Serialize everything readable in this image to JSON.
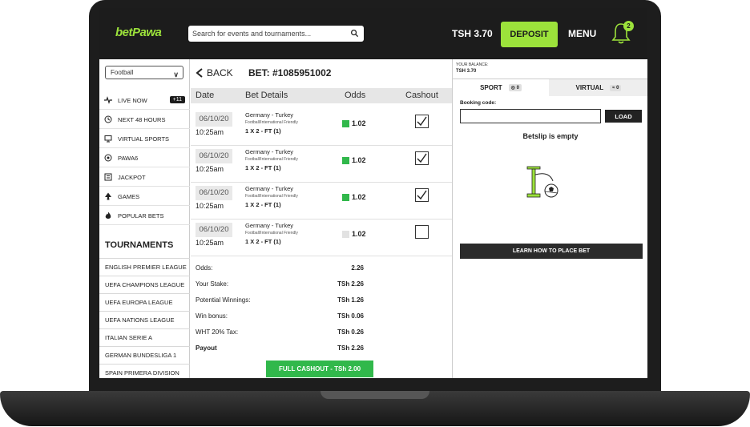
{
  "header": {
    "logo": "betPawa",
    "search_placeholder": "Search for events and tournaments...",
    "balance": "TSH 3.70",
    "deposit_label": "DEPOSIT",
    "menu_label": "MENU",
    "notification_count": "2"
  },
  "sidebar": {
    "sport_select": "Football",
    "nav": [
      {
        "label": "LIVE NOW",
        "icon": "pulse-icon",
        "count": "+11"
      },
      {
        "label": "NEXT 48 HOURS",
        "icon": "clock-icon"
      },
      {
        "label": "VIRTUAL SPORTS",
        "icon": "monitor-icon"
      },
      {
        "label": "PAWA6",
        "icon": "ball-icon"
      },
      {
        "label": "JACKPOT",
        "icon": "jackpot-icon"
      },
      {
        "label": "GAMES",
        "icon": "spade-icon"
      },
      {
        "label": "POPULAR BETS",
        "icon": "flame-icon"
      }
    ],
    "tournaments_heading": "TOURNAMENTS",
    "tournaments": [
      "ENGLISH PREMIER LEAGUE",
      "UEFA CHAMPIONS LEAGUE",
      "UEFA EUROPA LEAGUE",
      "UEFA NATIONS LEAGUE",
      "ITALIAN SERIE A",
      "GERMAN BUNDESLIGA 1",
      "SPAIN PRIMERA DIVISION"
    ]
  },
  "bet": {
    "back_label": "BACK",
    "title": "BET: #1085951002",
    "columns": [
      "Date",
      "Bet Details",
      "Odds",
      "Cashout"
    ],
    "rows": [
      {
        "date": "06/10/20",
        "time": "10:25am",
        "match": "Germany - Turkey",
        "competition": "Football/International Friendly",
        "pick": "1 X 2 - FT (1)",
        "odds": "1.02",
        "odds_active": true,
        "cashout_checked": true
      },
      {
        "date": "06/10/20",
        "time": "10:25am",
        "match": "Germany - Turkey",
        "competition": "Football/International Friendly",
        "pick": "1 X 2 - FT (1)",
        "odds": "1.02",
        "odds_active": true,
        "cashout_checked": true
      },
      {
        "date": "06/10/20",
        "time": "10:25am",
        "match": "Germany - Turkey",
        "competition": "Football/International Friendly",
        "pick": "1 X 2 - FT (1)",
        "odds": "1.02",
        "odds_active": true,
        "cashout_checked": true
      },
      {
        "date": "06/10/20",
        "time": "10:25am",
        "match": "Germany - Turkey",
        "competition": "Football/International Friendly",
        "pick": "1 X 2 - FT (1)",
        "odds": "1.02",
        "odds_active": false,
        "cashout_checked": false
      }
    ],
    "summary": [
      {
        "label": "Odds:",
        "value": "2.26"
      },
      {
        "label": "Your Stake:",
        "value": "TSh 2.26"
      },
      {
        "label": "Potential Winnings:",
        "value": "TSh 1.26"
      },
      {
        "label": "Win bonus:",
        "value": "TSh 0.06"
      },
      {
        "label": "WHT 20% Tax:",
        "value": "TSh 0.26"
      },
      {
        "label": "Payout",
        "value": "TSh 2.26"
      }
    ],
    "full_cashout_label": "FULL CASHOUT    - TSh 2.00"
  },
  "betslip": {
    "balance_label": "YOUR BALANCE:",
    "balance_value": "TSH 3.70",
    "tab_sport": "SPORT",
    "tab_sport_count": "0",
    "tab_virtual": "VIRTUAL",
    "tab_virtual_count": "0",
    "booking_label": "Booking code:",
    "load_label": "LOAD",
    "empty_text": "Betslip is empty",
    "learn_label": "LEARN HOW TO PLACE BET"
  },
  "colors": {
    "brand_green": "#9ce23b",
    "odds_green": "#31b84b",
    "topbar": "#1c1c1c"
  }
}
